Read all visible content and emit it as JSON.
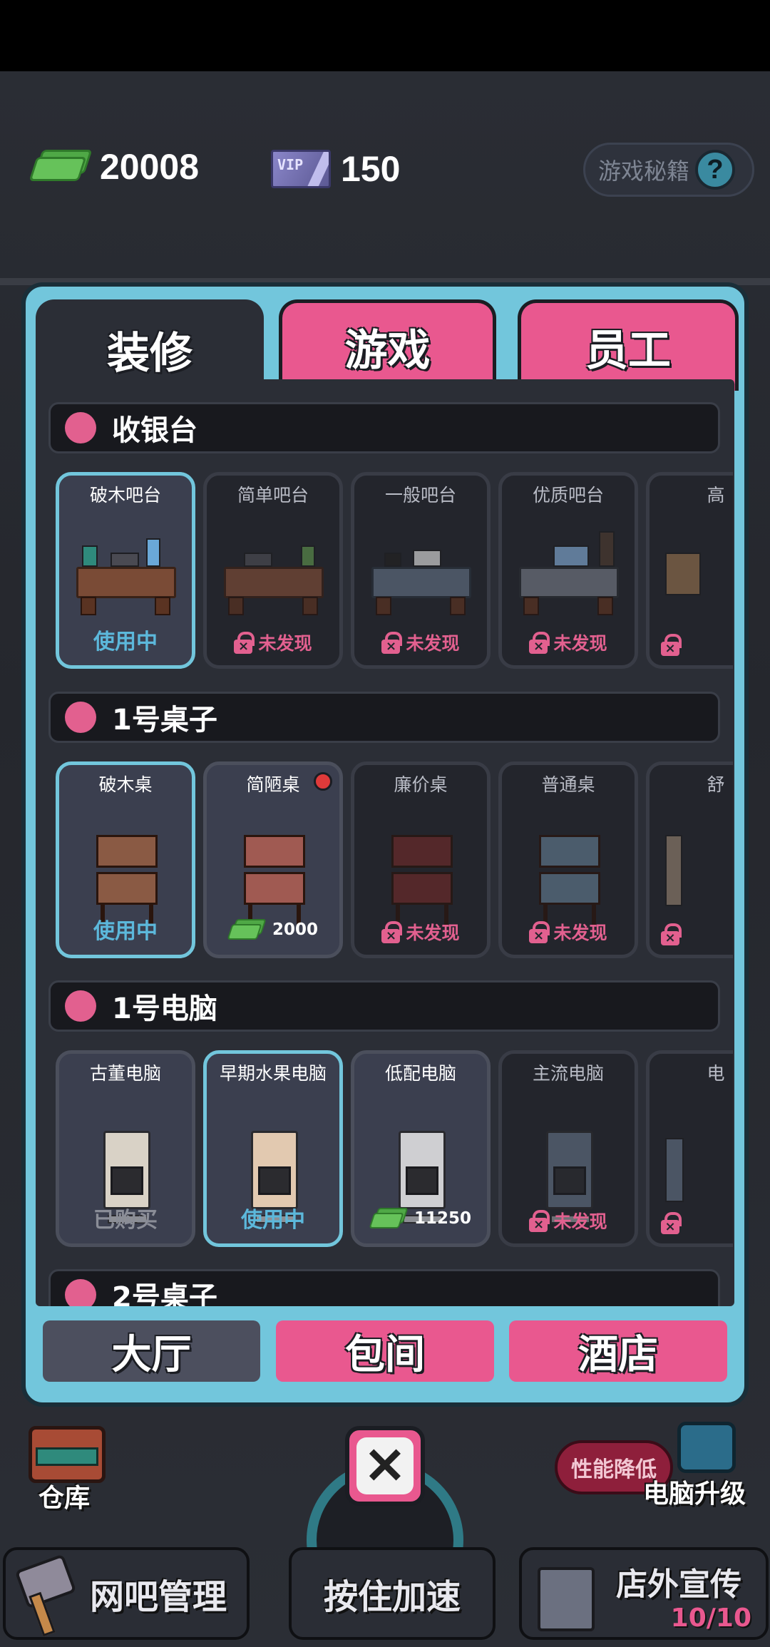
{
  "currency": {
    "cash": "20008",
    "vip_icon_text": "VIP",
    "vip": "150",
    "secret_label": "游戏秘籍",
    "help_glyph": "?"
  },
  "tabs": [
    "装修",
    "游戏",
    "员工"
  ],
  "sections": [
    {
      "title": "收银台",
      "items": [
        {
          "name": "破木吧台",
          "status": "使用中",
          "state": "in-use"
        },
        {
          "name": "简单吧台",
          "status": "未发现",
          "state": "locked"
        },
        {
          "name": "一般吧台",
          "status": "未发现",
          "state": "locked"
        },
        {
          "name": "优质吧台",
          "status": "未发现",
          "state": "locked"
        },
        {
          "name": "高",
          "status": "",
          "state": "locked"
        }
      ]
    },
    {
      "title": "1号桌子",
      "items": [
        {
          "name": "破木桌",
          "status": "使用中",
          "state": "in-use"
        },
        {
          "name": "简陋桌",
          "price": "2000",
          "state": "buy",
          "new": true
        },
        {
          "name": "廉价桌",
          "status": "未发现",
          "state": "locked"
        },
        {
          "name": "普通桌",
          "status": "未发现",
          "state": "locked"
        },
        {
          "name": "舒",
          "status": "",
          "state": "locked"
        }
      ]
    },
    {
      "title": "1号电脑",
      "items": [
        {
          "name": "古董电脑",
          "status": "已购买",
          "state": "bought"
        },
        {
          "name": "早期水果电脑",
          "status": "使用中",
          "state": "in-use"
        },
        {
          "name": "低配电脑",
          "price": "11250",
          "state": "buy"
        },
        {
          "name": "主流电脑",
          "status": "未发现",
          "state": "locked"
        },
        {
          "name": "电",
          "status": "",
          "state": "locked"
        }
      ]
    },
    {
      "title": "2号桌子",
      "items": []
    }
  ],
  "categories": [
    "大厅",
    "包间",
    "酒店"
  ],
  "hud": {
    "close_glyph": "✕",
    "storage": "仓库",
    "perf_badge": "性能降低",
    "pc_upgrade": "电脑升级",
    "management": "网吧管理",
    "speed_up": "按住加速",
    "promotion": "店外宣传",
    "promotion_count": "10/10"
  },
  "colors": {
    "accent_pink": "#e9588f",
    "accent_cyan": "#72c6dc",
    "in_use_text": "#5cb8db",
    "locked_text": "#e2608f"
  }
}
